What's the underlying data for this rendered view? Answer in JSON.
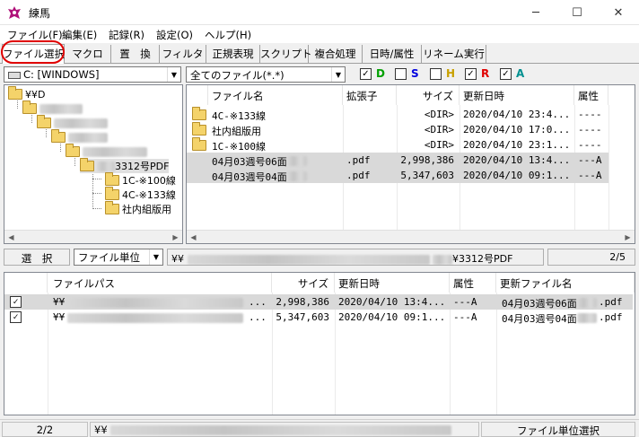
{
  "window": {
    "title": "練馬",
    "minimize": "─",
    "maximize": "☐",
    "close": "✕"
  },
  "menu": [
    "ファイル(F)",
    "編集(E)",
    "記録(R)",
    "設定(O)",
    "ヘルプ(H)"
  ],
  "tabs": [
    "ファイル選択",
    "マクロ",
    "置　換",
    "フィルタ",
    "正規表現",
    "スクリプト",
    "複合処理",
    "日時/属性",
    "リネーム実行"
  ],
  "drive_combo": "C: [WINDOWS]",
  "filter_combo": "全てのファイル(*.*)",
  "attr_checks": [
    {
      "label": "D",
      "checked": true,
      "color": "#00a000"
    },
    {
      "label": "S",
      "checked": false,
      "color": "#0000e0"
    },
    {
      "label": "H",
      "checked": false,
      "color": "#c8a000"
    },
    {
      "label": "R",
      "checked": true,
      "color": "#e00000"
    },
    {
      "label": "A",
      "checked": true,
      "color": "#009090"
    }
  ],
  "tree": {
    "root": "¥¥D",
    "selected_folder": "3312号PDF",
    "children": [
      "1C-※100線",
      "4C-※133線",
      "社内組版用"
    ]
  },
  "file_list": {
    "headers": [
      "ファイル名",
      "拡張子",
      "サイズ",
      "更新日時",
      "属性"
    ],
    "rows": [
      {
        "name": "4C-※133線",
        "ext": "",
        "size": "<DIR>",
        "date": "2020/04/10 23:4...",
        "attr": "----"
      },
      {
        "name": "社内組版用",
        "ext": "",
        "size": "<DIR>",
        "date": "2020/04/10 17:0...",
        "attr": "----"
      },
      {
        "name": "1C-※100線",
        "ext": "",
        "size": "<DIR>",
        "date": "2020/04/10 23:1...",
        "attr": "----"
      },
      {
        "name": "04月03週号06面",
        "ext": ".pdf",
        "size": "2,998,386",
        "date": "2020/04/10 13:4...",
        "attr": "---A"
      },
      {
        "name": "04月03週号04面",
        "ext": ".pdf",
        "size": "5,347,603",
        "date": "2020/04/10 09:1...",
        "attr": "---A"
      }
    ]
  },
  "select_button": "選　択",
  "unit_combo": "ファイル単位",
  "path_prefix": "¥¥",
  "path_suffix": "¥3312号PDF",
  "count": "2/5",
  "bottom_list": {
    "headers": [
      "ファイルパス",
      "サイズ",
      "更新日時",
      "属性",
      "更新ファイル名"
    ],
    "rows": [
      {
        "checked": true,
        "path": "¥¥",
        "path_tail": "...",
        "size": "2,998,386",
        "date": "2020/04/10 13:4...",
        "attr": "---A",
        "newname": "04月03週号06面",
        "newext": ".pdf"
      },
      {
        "checked": true,
        "path": "¥¥",
        "path_tail": "...",
        "size": "5,347,603",
        "date": "2020/04/10 09:1...",
        "attr": "---A",
        "newname": "04月03週号04面",
        "newext": ".pdf"
      }
    ]
  },
  "status": {
    "count": "2/2",
    "path": "¥¥",
    "mode": "ファイル単位選択"
  }
}
